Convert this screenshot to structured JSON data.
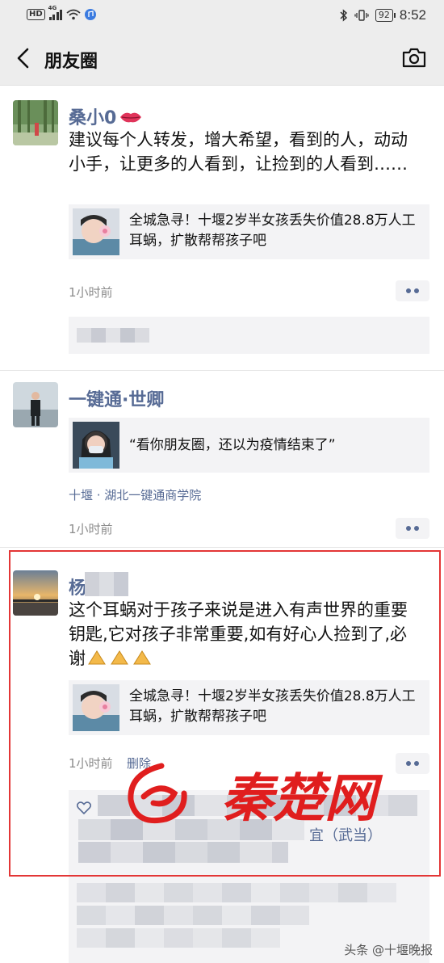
{
  "status_bar": {
    "hd": "HD",
    "network": "4G",
    "battery": "92",
    "time": "8:52"
  },
  "nav": {
    "title": "朋友圈"
  },
  "posts": [
    {
      "username": "桑小0",
      "text": "建议每个人转发，增大希望，看到的人，动动小手，让更多的人看到，让捡到的人看到……",
      "share_title": "全城急寻！十堰2岁半女孩丢失价值28.8万人工耳蜗，扩散帮帮孩子吧",
      "time": "1小时前"
    },
    {
      "username": "一键通·世卿",
      "share_title": "“看你朋友圈，还以为疫情结束了”",
      "location": "十堰 · 湖北一键通商学院",
      "time": "1小时前"
    },
    {
      "username": "杨",
      "text": "这个耳蜗对于孩子来说是进入有声世界的重要钥匙,它对孩子非常重要,如有好心人捡到了,必谢",
      "share_title": "全城急寻！十堰2岁半女孩丢失价值28.8万人工耳蜗，扩散帮帮孩子吧",
      "time": "1小时前",
      "delete_label": "删除",
      "comment_fragment": "宜（武当）"
    }
  ],
  "watermark": "秦楚网",
  "footer": "头条 @十堰晚报",
  "colors": {
    "username": "#576b95",
    "highlight_border": "#e33636",
    "share_bg": "#f3f3f5"
  }
}
